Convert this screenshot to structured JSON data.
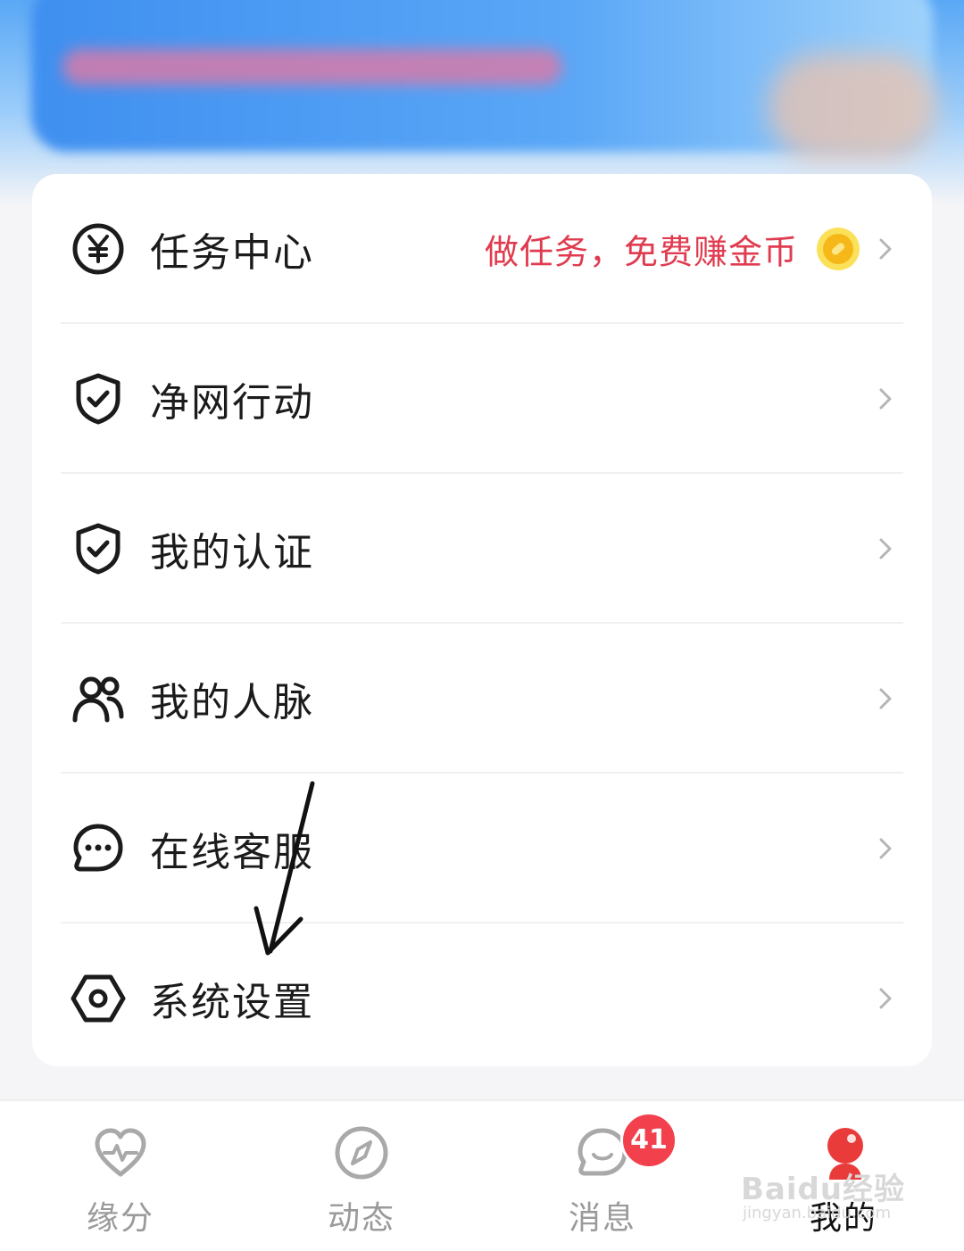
{
  "menu": {
    "items": [
      {
        "label": "任务中心",
        "icon": "yen-coin-icon",
        "hint": "做任务，免费赚金币",
        "hint_icon": "gold-coin-icon"
      },
      {
        "label": "净网行动",
        "icon": "shield-check-icon"
      },
      {
        "label": "我的认证",
        "icon": "shield-check-icon"
      },
      {
        "label": "我的人脉",
        "icon": "people-icon"
      },
      {
        "label": "在线客服",
        "icon": "chat-bubble-icon"
      },
      {
        "label": "系统设置",
        "icon": "settings-hexagon-icon"
      }
    ]
  },
  "tabbar": {
    "tabs": [
      {
        "label": "缘分",
        "icon": "heart-pulse-icon",
        "active": false
      },
      {
        "label": "动态",
        "icon": "compass-icon",
        "active": false
      },
      {
        "label": "消息",
        "icon": "chat-icon",
        "active": false,
        "badge": "41"
      },
      {
        "label": "我的",
        "icon": "profile-icon",
        "active": true
      }
    ]
  },
  "watermark": {
    "main": "Baidu经验",
    "sub": "jingyan.baidu.com"
  },
  "colors": {
    "hint": "#e03b4f",
    "badge": "#f2404d",
    "coin": "#f5b818",
    "active_tab": "#111111",
    "inactive_tab": "#9a9a9a"
  }
}
